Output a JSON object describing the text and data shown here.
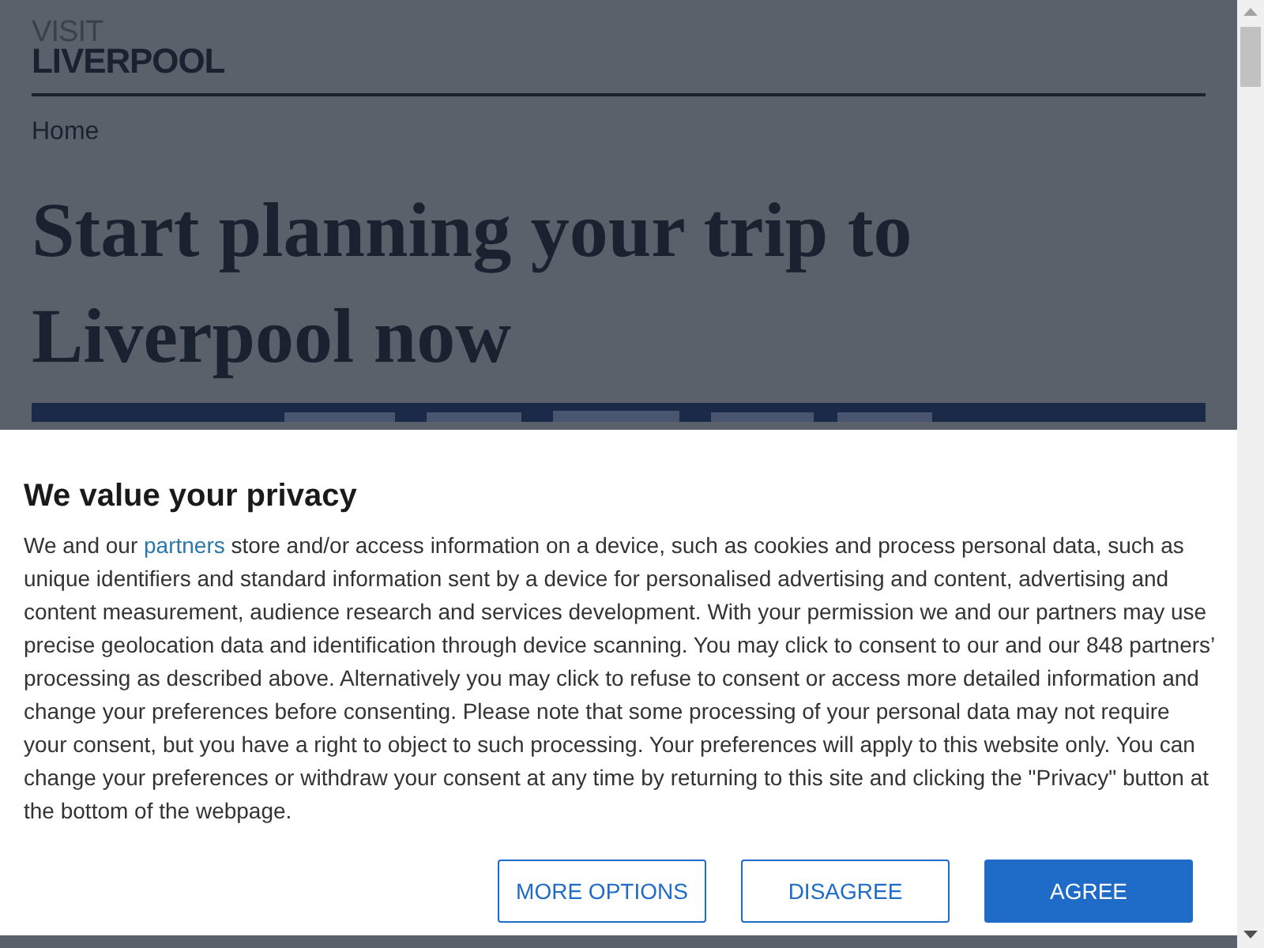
{
  "logo": {
    "top": "VISIT",
    "bottom": "LIVERPOOL"
  },
  "breadcrumb": "Home",
  "heading": "Start planning your trip to Liverpool now",
  "consent_dialog": {
    "title": "We value your privacy",
    "text_before": "We and our",
    "link": "partners",
    "text_after": "store and/or access information on a device, such as cookies and process personal data, such as unique identifiers and standard information sent by a device for personalised advertising and content, advertising and content measurement, audience research and services development. With your permission we and our partners may use precise geolocation data and identification through device scanning. You may click to consent to our and our 848 partners’ processing as described above. Alternatively you may click to refuse to consent or access more detailed information and change your preferences before consenting. Please note that some processing of your personal data may not require your consent, but you have a right to object to such processing. Your preferences will apply to this website only. You can change your preferences or withdraw your consent at any time by returning to this site and clicking the \"Privacy\" button at the bottom of the webpage.",
    "buttons": [
      {
        "label": "MORE OPTIONS",
        "kind": "outline"
      },
      {
        "label": "DISAGREE",
        "kind": "outline"
      },
      {
        "label": "AGREE",
        "kind": "primary"
      }
    ]
  }
}
